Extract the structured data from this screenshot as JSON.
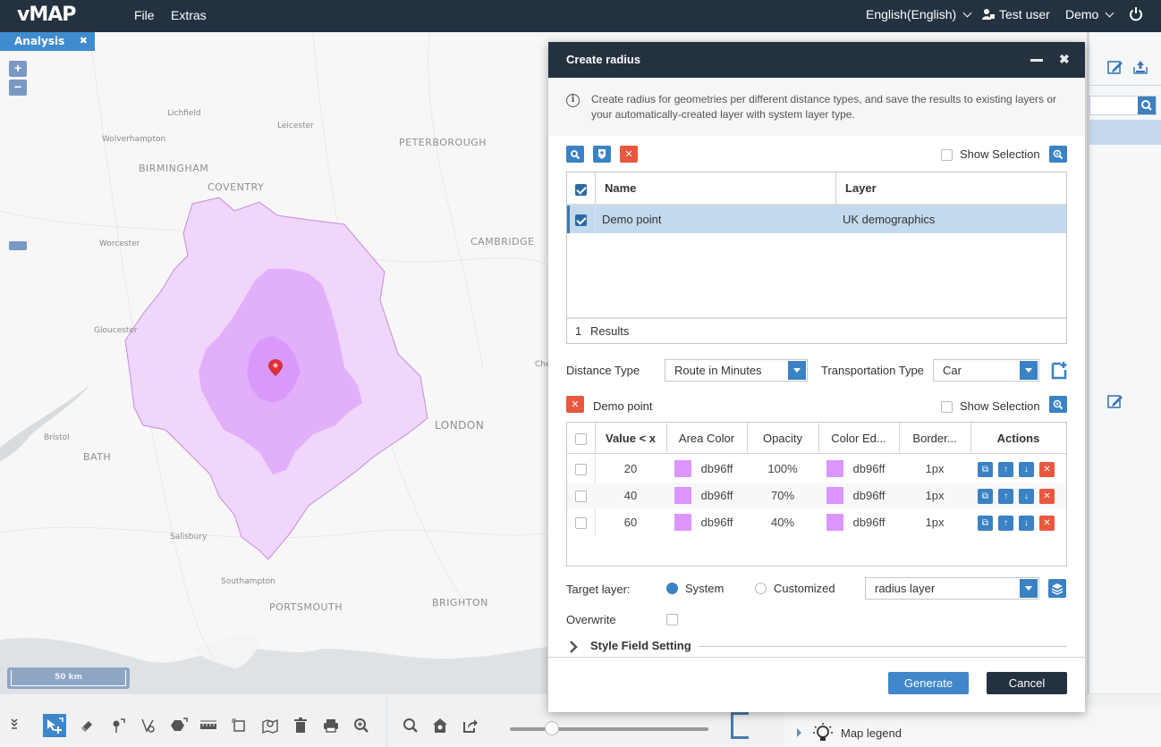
{
  "app": {
    "logo": "vMAP",
    "menu": [
      "File",
      "Extras"
    ],
    "language": "English(English)",
    "user": "Test user",
    "workspace": "Demo",
    "icons": {
      "user": "user-icon",
      "power": "power-icon",
      "language_dropdown": "chevron-down-icon"
    }
  },
  "map": {
    "active_tab": "Analysis",
    "zoom_in": "+",
    "zoom_out": "−",
    "scale": "50 km",
    "labels": [
      {
        "text": "Lichfield",
        "kind": "town"
      },
      {
        "text": "Leicester",
        "kind": "town"
      },
      {
        "text": "Wolverhampton",
        "kind": "town"
      },
      {
        "text": "PETERBOROUGH",
        "kind": "city"
      },
      {
        "text": "BIRMINGHAM",
        "kind": "city"
      },
      {
        "text": "COVENTRY",
        "kind": "city"
      },
      {
        "text": "Worcester",
        "kind": "town"
      },
      {
        "text": "CAMBRIDGE",
        "kind": "city"
      },
      {
        "text": "Gloucester",
        "kind": "town"
      },
      {
        "text": "Che",
        "kind": "town"
      },
      {
        "text": "LONDON",
        "kind": "city"
      },
      {
        "text": "Bristol",
        "kind": "town"
      },
      {
        "text": "BATH",
        "kind": "city"
      },
      {
        "text": "Salisbury",
        "kind": "town"
      },
      {
        "text": "Southampton",
        "kind": "town"
      },
      {
        "text": "PORTSMOUTH",
        "kind": "city"
      },
      {
        "text": "BRIGHTON",
        "kind": "city"
      }
    ],
    "radius_color": "#db96ff",
    "marker_color": "#d9303a"
  },
  "dialog": {
    "title": "Create radius",
    "info": "Create radius for geometries per different distance types, and save the results to existing layers or your automatically-created layer with system layer type.",
    "show_selection_label": "Show Selection",
    "geometry_table": {
      "columns": [
        "Name",
        "Layer"
      ],
      "rows": [
        {
          "name": "Demo point",
          "layer": "UK demographics",
          "checked": true,
          "selected": true
        }
      ],
      "results_count": "1",
      "results_label": "Results"
    },
    "distance_type_label": "Distance Type",
    "distance_type_value": "Route in Minutes",
    "transport_type_label": "Transportation Type",
    "transport_type_value": "Car",
    "current_geometry": "Demo point",
    "ranges_table": {
      "columns": [
        "Value < x",
        "Area Color",
        "Opacity",
        "Color Ed...",
        "Border...",
        "Actions"
      ],
      "rows": [
        {
          "value": "20",
          "area_color": "db96ff",
          "opacity": "100%",
          "edge_color": "db96ff",
          "border": "1px"
        },
        {
          "value": "40",
          "area_color": "db96ff",
          "opacity": "70%",
          "edge_color": "db96ff",
          "border": "1px"
        },
        {
          "value": "60",
          "area_color": "db96ff",
          "opacity": "40%",
          "edge_color": "db96ff",
          "border": "1px"
        }
      ]
    },
    "target_layer_label": "Target layer:",
    "target_options": [
      "System",
      "Customized"
    ],
    "target_selected": "System",
    "target_layer_value": "radius layer",
    "overwrite_label": "Overwrite",
    "overwrite_checked": false,
    "style_field_label": "Style Field Setting",
    "generate_label": "Generate",
    "cancel_label": "Cancel",
    "minimize": "▁",
    "close": "✖"
  },
  "bottom": {
    "map_legend_label": "Map legend",
    "zoom_slider_fraction": 0.21
  },
  "colors": {
    "topbar": "#243141",
    "accent": "#3f86ca",
    "danger": "#e9573f",
    "swatch": "#db96ff"
  }
}
